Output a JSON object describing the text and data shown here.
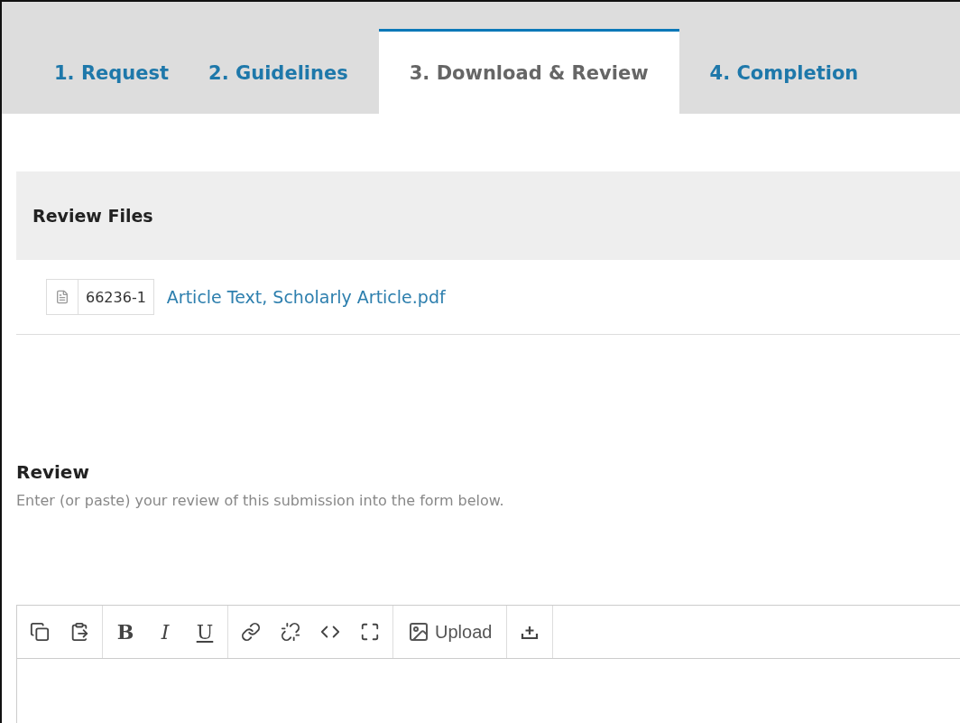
{
  "tabs": [
    {
      "label": "1. Request",
      "selected": false
    },
    {
      "label": "2. Guidelines",
      "selected": false
    },
    {
      "label": "3. Download & Review",
      "selected": true
    },
    {
      "label": "4. Completion",
      "selected": false
    }
  ],
  "review_files": {
    "title": "Review Files",
    "files": [
      {
        "id": "66236-1",
        "name": "Article Text, Scholarly Article.pdf"
      }
    ]
  },
  "review": {
    "title": "Review",
    "description": "Enter (or paste) your review of this submission into the form below.",
    "toolbar": {
      "format_buttons": [
        "B",
        "I",
        "U"
      ],
      "upload_label": "Upload"
    }
  }
}
